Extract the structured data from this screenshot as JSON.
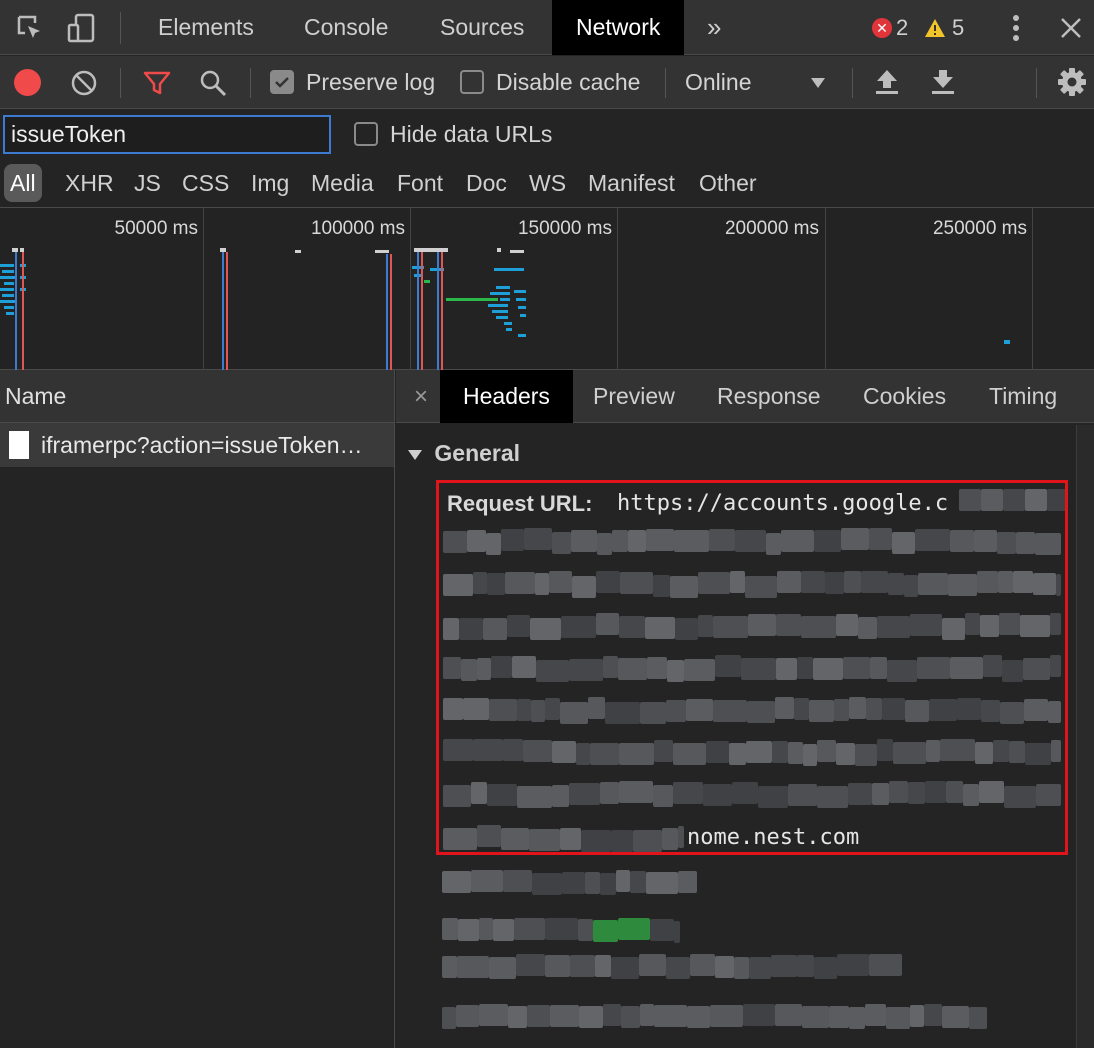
{
  "tabs": {
    "elements": "Elements",
    "console": "Console",
    "sources": "Sources",
    "network": "Network",
    "more": "»"
  },
  "status": {
    "errors": "2",
    "warnings": "5"
  },
  "toolbar": {
    "preserve_log": "Preserve log",
    "disable_cache": "Disable cache",
    "throttle": "Online"
  },
  "filter": {
    "value": "issueToken",
    "hide_data_urls": "Hide data URLs",
    "types": [
      "All",
      "XHR",
      "JS",
      "CSS",
      "Img",
      "Media",
      "Font",
      "Doc",
      "WS",
      "Manifest",
      "Other"
    ]
  },
  "overview": {
    "ticks": [
      "50000 ms",
      "100000 ms",
      "150000 ms",
      "200000 ms",
      "250000 ms"
    ]
  },
  "requests": {
    "column": "Name",
    "rows": [
      "iframerpc?action=issueToken…"
    ]
  },
  "details": {
    "close": "×",
    "tabs": [
      "Headers",
      "Preview",
      "Response",
      "Cookies",
      "Timing"
    ],
    "section": "General",
    "request_url_label": "Request URL:",
    "request_url_start": "https://accounts.google.c",
    "request_url_end": "nome.nest.com"
  },
  "colors": {
    "highlight_border": "#e1141b",
    "record": "#f04a4a",
    "filter_active": "#f04a4a",
    "error": "#e0363b",
    "warning": "#f3c32a",
    "focus": "#3d7bd1"
  }
}
